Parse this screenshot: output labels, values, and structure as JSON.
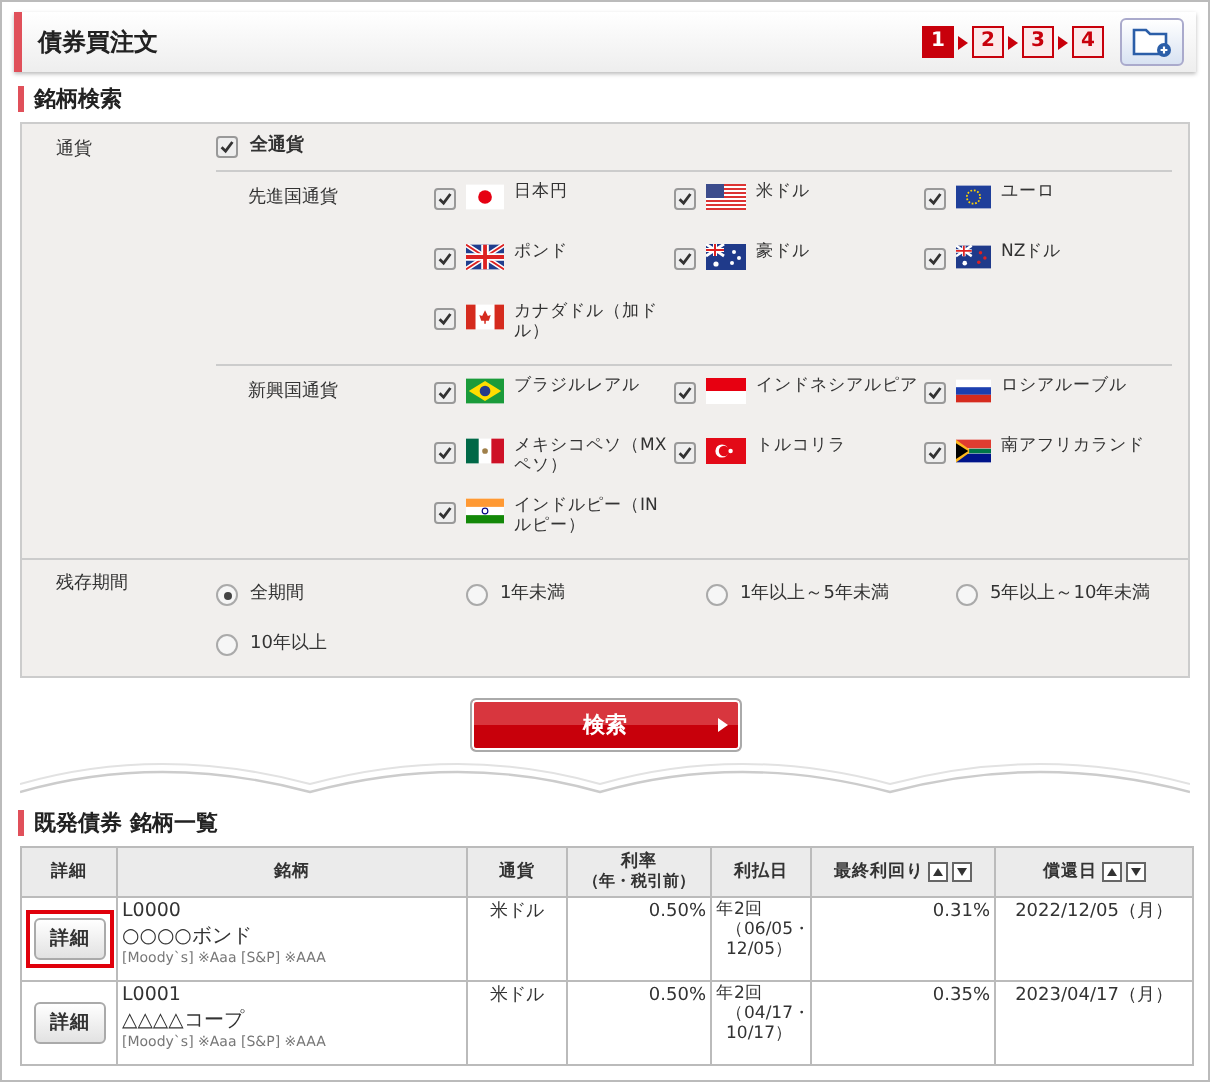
{
  "header": {
    "title": "債券買注文",
    "steps": [
      {
        "label": "1",
        "selected": true
      },
      {
        "label": "2",
        "selected": false
      },
      {
        "label": "3",
        "selected": false
      },
      {
        "label": "4",
        "selected": false
      }
    ]
  },
  "search": {
    "title": "銘柄検索",
    "currency": {
      "label": "通貨",
      "all": {
        "label": "全通貨",
        "checked": true
      },
      "groups": [
        {
          "label": "先進国通貨",
          "items": [
            {
              "label": "日本円",
              "checked": true
            },
            {
              "label": "米ドル",
              "checked": true
            },
            {
              "label": "ユーロ",
              "checked": true
            },
            {
              "label": "ポンド",
              "checked": true
            },
            {
              "label": "豪ドル",
              "checked": true
            },
            {
              "label": "NZドル",
              "checked": true
            },
            {
              "label": "カナダドル（加ドル）",
              "checked": true
            }
          ]
        },
        {
          "label": "新興国通貨",
          "items": [
            {
              "label": "ブラジルレアル",
              "checked": true
            },
            {
              "label": "インドネシアルピア",
              "checked": true
            },
            {
              "label": "ロシアルーブル",
              "checked": true
            },
            {
              "label": "メキシコペソ（MXペソ）",
              "checked": true
            },
            {
              "label": "トルコリラ",
              "checked": true
            },
            {
              "label": "南アフリカランド",
              "checked": true
            },
            {
              "label": "インドルピー（INルピー）",
              "checked": true
            }
          ]
        }
      ]
    },
    "period": {
      "label": "残存期間",
      "options": [
        {
          "label": "全期間",
          "selected": true
        },
        {
          "label": "1年未満",
          "selected": false
        },
        {
          "label": "1年以上～5年未満",
          "selected": false
        },
        {
          "label": "5年以上～10年未満",
          "selected": false
        },
        {
          "label": "10年以上",
          "selected": false
        }
      ]
    },
    "button": "検索"
  },
  "list": {
    "title": "既発債券 銘柄一覧",
    "columns": [
      {
        "label": "詳細",
        "sortable": false
      },
      {
        "label": "銘柄",
        "sortable": false
      },
      {
        "label": "通貨",
        "sortable": false
      },
      {
        "label": "利率",
        "sublabel": "（年・税引前）",
        "sortable": false
      },
      {
        "label": "利払日",
        "sortable": false
      },
      {
        "label": "最終利回り",
        "sortable": true
      },
      {
        "label": "償還日",
        "sortable": true
      }
    ],
    "rows": [
      {
        "button": "詳細",
        "highlighted": true,
        "code": "L0000",
        "name": "○○○○ボンド",
        "rating": "[Moody`s] ※Aaa [S&P] ※AAA",
        "currency": "米ドル",
        "rate": "0.50%",
        "payment": "年2回",
        "payment_dates": "（06/05・12/05）",
        "yield": "0.31%",
        "maturity": "2022/12/05（月）"
      },
      {
        "button": "詳細",
        "highlighted": false,
        "code": "L0001",
        "name": "△△△△コープ",
        "rating": "[Moody`s] ※Aaa [S&P] ※AAA",
        "currency": "米ドル",
        "rate": "0.50%",
        "payment": "年2回",
        "payment_dates": "（04/17・10/17）",
        "yield": "0.35%",
        "maturity": "2023/04/17（月）"
      }
    ]
  }
}
